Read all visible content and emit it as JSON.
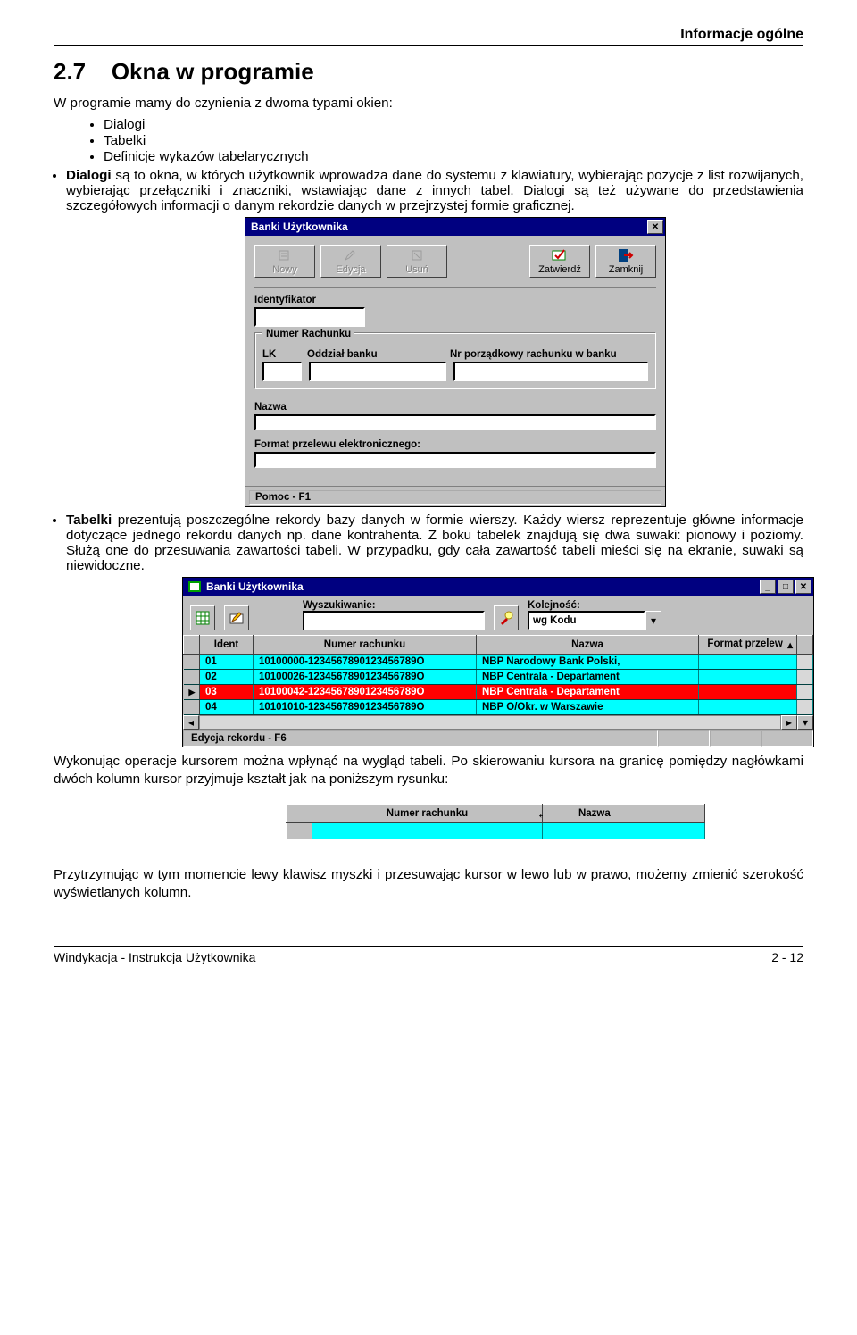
{
  "header": {
    "right": "Informacje ogólne"
  },
  "section": {
    "num": "2.7",
    "title": "Okna w programie"
  },
  "p_intro": "W programie mamy do czynienia z dwoma typami okien:",
  "list_types": [
    "Dialogi",
    "Tabelki",
    "Definicje wykazów tabelarycznych"
  ],
  "p_dialogi_lead": "Dialogi",
  "p_dialogi": " są to okna, w których użytkownik wprowadza dane do systemu z klawiatury, wybierając pozycje z list rozwijanych, wybierając przełączniki i znaczniki, wstawiając dane z innych tabel. Dialogi są też używane do przedstawienia szczegółowych informacji o danym rekordzie danych w przejrzystej formie graficznej.",
  "dialog": {
    "title": "Banki Użytkownika",
    "toolbar": {
      "nowy": "Nowy",
      "edycja": "Edycja",
      "usun": "Usuń",
      "zatwierdz": "Zatwierdź",
      "zamknij": "Zamknij"
    },
    "fields": {
      "ident": "Identyfikator",
      "numer": "Numer Rachunku",
      "lk": "LK",
      "oddzial": "Oddział banku",
      "nrporz": "Nr porządkowy rachunku w banku",
      "nazwa": "Nazwa",
      "format": "Format przelewu elektronicznego:",
      "pomoc": "Pomoc - F1"
    }
  },
  "p_tabelki_lead": "Tabelki",
  "p_tabelki": " prezentują poszczególne rekordy bazy danych w formie wierszy. Każdy wiersz reprezentuje główne informacje dotyczące jednego rekordu danych np. dane kontrahenta. Z boku tabelek znajdują się dwa suwaki: pionowy i poziomy. Służą one do przesuwania zawartości tabeli. W przypadku, gdy cała zawartość tabeli mieści się na ekranie, suwaki są niewidoczne.",
  "table_win": {
    "title": "Banki Użytkownika",
    "search_label": "Wyszukiwanie:",
    "order_label": "Kolejność:",
    "order_value": "wg Kodu",
    "columns": [
      "Ident",
      "Numer rachunku",
      "Nazwa",
      "Format przelew"
    ],
    "rows": [
      {
        "ident": "01",
        "numer": "10100000-1234567890123456789O",
        "nazwa": "NBP Narodowy Bank Polski,",
        "selected": false
      },
      {
        "ident": "02",
        "numer": "10100026-1234567890123456789O",
        "nazwa": "NBP Centrala - Departament",
        "selected": false
      },
      {
        "ident": "03",
        "numer": "10100042-1234567890123456789O",
        "nazwa": "NBP Centrala - Departament",
        "selected": true
      },
      {
        "ident": "04",
        "numer": "10101010-1234567890123456789O",
        "nazwa": "NBP O/Okr. w Warszawie",
        "selected": false
      }
    ],
    "status": "Edycja rekordu - F6"
  },
  "p_after_table": "Wykonując operacje kursorem można wpłynąć na wygląd tabeli. Po skierowaniu kursora na granicę pomiędzy nagłówkami dwóch kolumn kursor przyjmuje kształt jak na poniższym rysunku:",
  "colhead": {
    "c1": "Numer rachunku",
    "c2": "Nazwa"
  },
  "p_resize": "Przytrzymując w tym momencie lewy klawisz myszki i przesuwając kursor w lewo lub w prawo, możemy zmienić szerokość wyświetlanych kolumn.",
  "footer": {
    "left": "Windykacja - Instrukcja Użytkownika",
    "right": "2 - 12"
  }
}
